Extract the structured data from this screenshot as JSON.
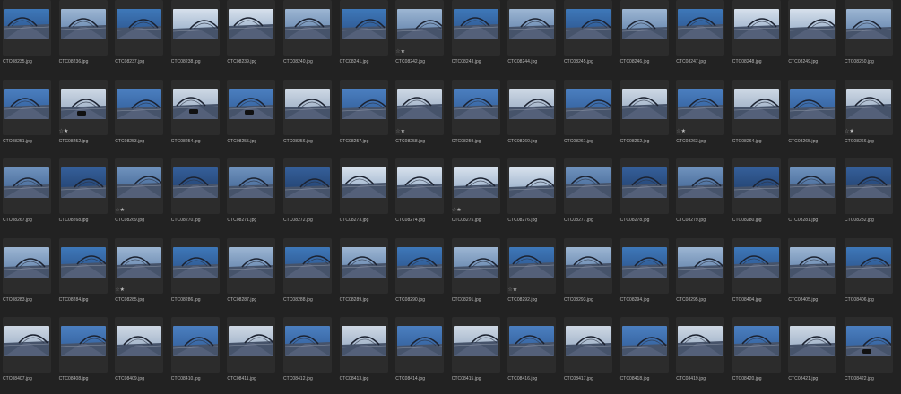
{
  "thumbnails": [
    [
      "CTC08235.jpg",
      "CTC08236.jpg",
      "CTC08237.jpg",
      "CTC08238.jpg",
      "CTC08239.jpg",
      "CTC08240.jpg",
      "CTC08241.jpg",
      "CTC08242.jpg",
      "CTC08243.jpg",
      "CTC08244.jpg",
      "CTC08245.jpg",
      "CTC08246.jpg",
      "CTC08247.jpg",
      "CTC08248.jpg",
      "CTC08249.jpg",
      "CTC08250.jpg"
    ],
    [
      "CTC08251.jpg",
      "CTC08252.jpg",
      "CTC08253.jpg",
      "CTC08254.jpg",
      "CTC08255.jpg",
      "CTC08256.jpg",
      "CTC08257.jpg",
      "CTC08258.jpg",
      "CTC08259.jpg",
      "CTC08260.jpg",
      "CTC08261.jpg",
      "CTC08262.jpg",
      "CTC08263.jpg",
      "CTC08264.jpg",
      "CTC08265.jpg",
      "CTC08266.jpg"
    ],
    [
      "CTC08267.jpg",
      "CTC08268.jpg",
      "CTC08269.jpg",
      "CTC08270.jpg",
      "CTC08271.jpg",
      "CTC08272.jpg",
      "CTC08273.jpg",
      "CTC08274.jpg",
      "CTC08275.jpg",
      "CTC08276.jpg",
      "CTC08277.jpg",
      "CTC08278.jpg",
      "CTC08279.jpg",
      "CTC08280.jpg",
      "CTC08281.jpg",
      "CTC08282.jpg"
    ],
    [
      "CTC08283.jpg",
      "CTC08284.jpg",
      "CTC08285.jpg",
      "CTC08286.jpg",
      "CTC08287.jpg",
      "CTC08288.jpg",
      "CTC08289.jpg",
      "CTC08290.jpg",
      "CTC08291.jpg",
      "CTC08292.jpg",
      "CTC08293.jpg",
      "CTC08294.jpg",
      "CTC08295.jpg",
      "CTC08404.jpg",
      "CTC08405.jpg",
      "CTC08406.jpg"
    ],
    [
      "CTC08407.jpg",
      "CTC08408.jpg",
      "CTC08409.jpg",
      "CTC08410.jpg",
      "CTC08411.jpg",
      "CTC08412.jpg",
      "CTC08413.jpg",
      "CTC08414.jpg",
      "CTC08415.jpg",
      "CTC08416.jpg",
      "CTC08417.jpg",
      "CTC08418.jpg",
      "CTC08419.jpg",
      "CTC08420.jpg",
      "CTC08421.jpg",
      "CTC08422.jpg"
    ]
  ],
  "rated": [
    "CTC08242.jpg",
    "CTC08252.jpg",
    "CTC08258.jpg",
    "CTC08263.jpg",
    "CTC08266.jpg",
    "CTC08269.jpg",
    "CTC08275.jpg",
    "CTC08285.jpg",
    "CTC08292.jpg"
  ],
  "rating_text": {
    "empty": "☆",
    "filled": "★"
  },
  "colors": {
    "background": "#222222",
    "cell": "#2c2c2c",
    "filename": "#b9b9b9",
    "sky_dusk": "#3b6fae",
    "sky_bright": "#c9d6e6",
    "road": "#4a5566"
  }
}
